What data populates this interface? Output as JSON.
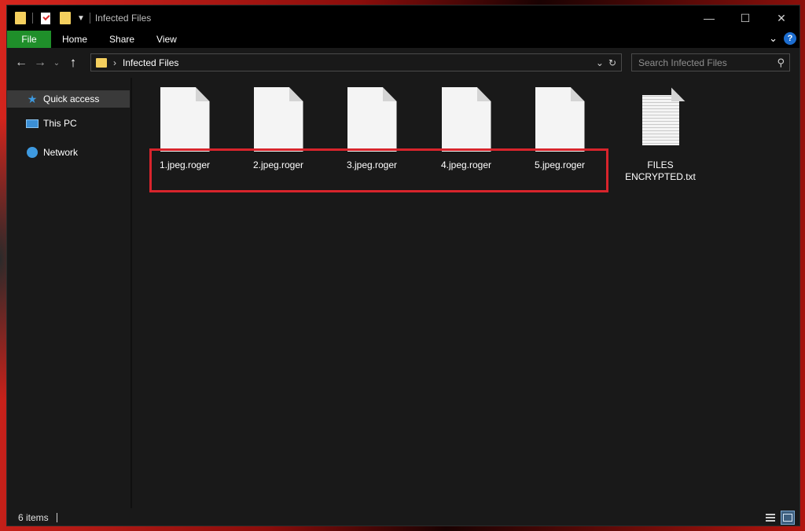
{
  "window": {
    "title": "Infected Files"
  },
  "ribbon": {
    "tabs": [
      "File",
      "Home",
      "Share",
      "View"
    ]
  },
  "navigation": {
    "address_current": "Infected Files",
    "search_placeholder": "Search Infected Files"
  },
  "sidebar": {
    "items": [
      {
        "label": "Quick access",
        "icon": "star-icon"
      },
      {
        "label": "This PC",
        "icon": "computer-icon"
      },
      {
        "label": "Network",
        "icon": "network-icon"
      }
    ]
  },
  "files": [
    {
      "name": "1.jpeg.roger",
      "icon": "blank-document-icon"
    },
    {
      "name": "2.jpeg.roger",
      "icon": "blank-document-icon"
    },
    {
      "name": "3.jpeg.roger",
      "icon": "blank-document-icon"
    },
    {
      "name": "4.jpeg.roger",
      "icon": "blank-document-icon"
    },
    {
      "name": "5.jpeg.roger",
      "icon": "blank-document-icon"
    },
    {
      "name": "FILES ENCRYPTED.txt",
      "icon": "text-document-icon"
    }
  ],
  "status": {
    "item_count": "6 items"
  },
  "colors": {
    "file_tab": "#1f8f2a",
    "highlight_box": "#d8242c",
    "help_icon": "#1c6dd0"
  }
}
